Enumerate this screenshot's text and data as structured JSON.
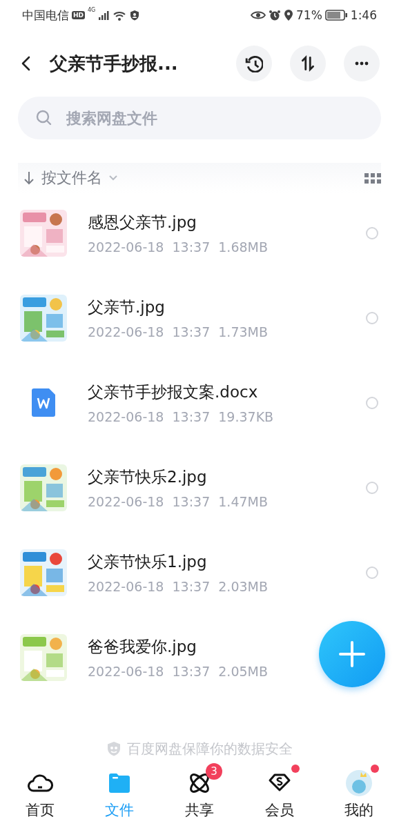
{
  "status_bar": {
    "carrier": "中国电信",
    "hd_badge": "HD",
    "network": "4G",
    "battery": "71%",
    "time": "1:46"
  },
  "header": {
    "title": "父亲节手抄报..."
  },
  "search": {
    "placeholder": "搜索网盘文件"
  },
  "sort": {
    "label": "按文件名"
  },
  "files": [
    {
      "kind": "picture",
      "name": "感恩父亲节.jpg",
      "date": "2022-06-18",
      "time": "13:37",
      "size": "1.68MB",
      "selected": false
    },
    {
      "kind": "picture",
      "name": "父亲节.jpg",
      "date": "2022-06-18",
      "time": "13:37",
      "size": "1.73MB",
      "selected": false
    },
    {
      "kind": "doc",
      "name": "父亲节手抄报文案.docx",
      "date": "2022-06-18",
      "time": "13:37",
      "size": "19.37KB",
      "selected": false
    },
    {
      "kind": "picture",
      "name": "父亲节快乐2.jpg",
      "date": "2022-06-18",
      "time": "13:37",
      "size": "1.47MB",
      "selected": false
    },
    {
      "kind": "picture",
      "name": "父亲节快乐1.jpg",
      "date": "2022-06-18",
      "time": "13:37",
      "size": "2.03MB",
      "selected": false
    },
    {
      "kind": "picture",
      "name": "爸爸我爱你.jpg",
      "date": "2022-06-18",
      "time": "13:37",
      "size": "2.05MB"
    }
  ],
  "footer_note": "百度网盘保障你的数据安全",
  "tabs": [
    {
      "kind": "home",
      "label": "首页",
      "selected": false,
      "dot": false
    },
    {
      "kind": "files",
      "label": "文件",
      "selected": true,
      "dot": false
    },
    {
      "kind": "share",
      "label": "共享",
      "selected": false,
      "badge": "3",
      "dot": false
    },
    {
      "kind": "vip",
      "label": "会员",
      "selected": false,
      "dot": true
    },
    {
      "kind": "me",
      "label": "我的",
      "selected": false,
      "dot": true
    }
  ]
}
